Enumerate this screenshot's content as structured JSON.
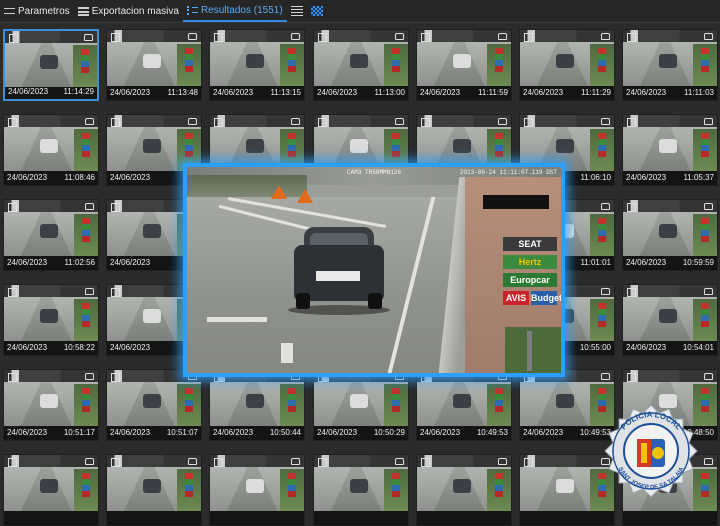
{
  "toolbar": {
    "tabs": [
      {
        "label": "Parametros",
        "icon": "sliders-icon"
      },
      {
        "label": "Exportacion masiva",
        "icon": "list-icon"
      },
      {
        "label": "Resultados (1551)",
        "icon": "results-list-icon",
        "active": true
      }
    ],
    "view_buttons": [
      {
        "icon": "rows-view-icon"
      },
      {
        "icon": "grid-view-icon",
        "active": true
      }
    ],
    "accent_color": "#2f8be0"
  },
  "grid": {
    "rows": [
      {
        "cards": [
          {
            "date": "24/06/2023",
            "time": "11:14:29",
            "selected": true
          },
          {
            "date": "24/06/2023",
            "time": "11:13:48"
          },
          {
            "date": "24/06/2023",
            "time": "11:13:15"
          },
          {
            "date": "24/06/2023",
            "time": "11:13:00"
          },
          {
            "date": "24/06/2023",
            "time": "11:11:59"
          },
          {
            "date": "24/06/2023",
            "time": "11:11:29"
          },
          {
            "date": "24/06/2023",
            "time": "11:11:03"
          }
        ]
      },
      {
        "cards": [
          {
            "date": "24/06/2023",
            "time": "11:08:46"
          },
          {
            "date": "24/06/2023",
            "time": ""
          },
          {
            "date": "",
            "time": ""
          },
          {
            "date": "",
            "time": ""
          },
          {
            "date": "",
            "time": ""
          },
          {
            "date": "",
            "time": "11:06:10"
          },
          {
            "date": "24/06/2023",
            "time": "11:05:37"
          }
        ]
      },
      {
        "cards": [
          {
            "date": "24/06/2023",
            "time": "11:02:56"
          },
          {
            "date": "24/06/2023",
            "time": ""
          },
          {
            "date": "",
            "time": ""
          },
          {
            "date": "",
            "time": ""
          },
          {
            "date": "",
            "time": ""
          },
          {
            "date": "",
            "time": "11:01:01"
          },
          {
            "date": "24/06/2023",
            "time": "10:59:59"
          }
        ]
      },
      {
        "cards": [
          {
            "date": "24/06/2023",
            "time": "10:58:22"
          },
          {
            "date": "24/06/2023",
            "time": "10:5"
          },
          {
            "date": "",
            "time": ""
          },
          {
            "date": "",
            "time": ""
          },
          {
            "date": "",
            "time": ""
          },
          {
            "date": "",
            "time": "10:55:00"
          },
          {
            "date": "24/06/2023",
            "time": "10:54:01"
          }
        ]
      },
      {
        "cards": [
          {
            "date": "24/06/2023",
            "time": "10:51:17"
          },
          {
            "date": "24/06/2023",
            "time": "10:51:07"
          },
          {
            "date": "24/06/2023",
            "time": "10:50:44"
          },
          {
            "date": "24/06/2023",
            "time": "10:50:29"
          },
          {
            "date": "24/06/2023",
            "time": "10:49:53"
          },
          {
            "date": "24/06/2023",
            "time": "10:49:53"
          },
          {
            "date": "24/06/2023",
            "time": "10:48:50"
          }
        ]
      },
      {
        "cards": [
          {
            "date": "",
            "time": ""
          },
          {
            "date": "",
            "time": ""
          },
          {
            "date": "",
            "time": ""
          },
          {
            "date": "",
            "time": ""
          },
          {
            "date": "",
            "time": ""
          },
          {
            "date": "",
            "time": ""
          },
          {
            "date": "",
            "time": ""
          }
        ]
      }
    ]
  },
  "preview": {
    "camera_label": "CAM3 TR50MMN126",
    "timestamp": "2023-06-24 11:11:07.119 DST",
    "sign_brands": [
      "SEAT",
      "Hertz",
      "Europcar",
      "AVIS",
      "Budget"
    ],
    "sign_colors": {
      "SEAT": "#c9342b",
      "Hertz": "#f2c200",
      "Europcar": "#3b8a3e",
      "AVIS": "#c9242a",
      "Budget": "#2a5ea8"
    },
    "highlight_color": "#2aa0ff"
  },
  "badge": {
    "text_top": "POLICIA LOCAL",
    "text_bottom": "SANT JOSEP DE SA TALAIA"
  }
}
